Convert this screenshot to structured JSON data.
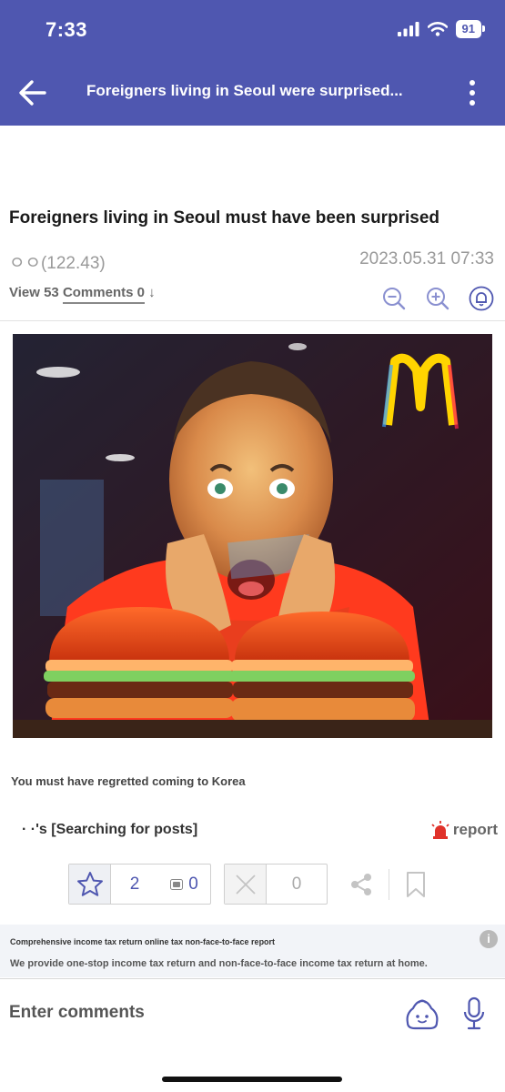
{
  "status_bar": {
    "time": "7:33",
    "battery": "91"
  },
  "nav": {
    "title": "Foreigners living in Seoul were surprised..."
  },
  "post": {
    "title": "Foreigners living in Seoul must have been surprised",
    "author": "ㅇㅇ(122.43)",
    "date": "2023.05.31 07:33",
    "view_label": "View 53",
    "comments_label": "Comments",
    "comments_count": "0",
    "arrow": "↓",
    "caption": "You must have regretted coming to Korea",
    "search_posts": "·  ·'s [Searching for posts]",
    "report_label": "report"
  },
  "actions": {
    "recommend_count": "2",
    "fixed_count": "0",
    "not_recommend_count": "0"
  },
  "ad": {
    "title": "Comprehensive income tax return online tax non-face-to-face report",
    "description": "We provide one-stop income tax return and non-face-to-face income tax return at home.",
    "info": "i"
  },
  "comment_bar": {
    "placeholder": "Enter comments"
  },
  "icons": [
    "back-arrow-icon",
    "more-vertical-icon",
    "zoom-out-icon",
    "zoom-in-icon",
    "bell-icon",
    "star-icon",
    "x-icon",
    "share-icon",
    "bookmark-icon",
    "siren-icon",
    "emoji-icon",
    "microphone-icon"
  ],
  "colors": {
    "brand": "#4f57b0",
    "report": "#e0322a",
    "muted": "#999999"
  }
}
